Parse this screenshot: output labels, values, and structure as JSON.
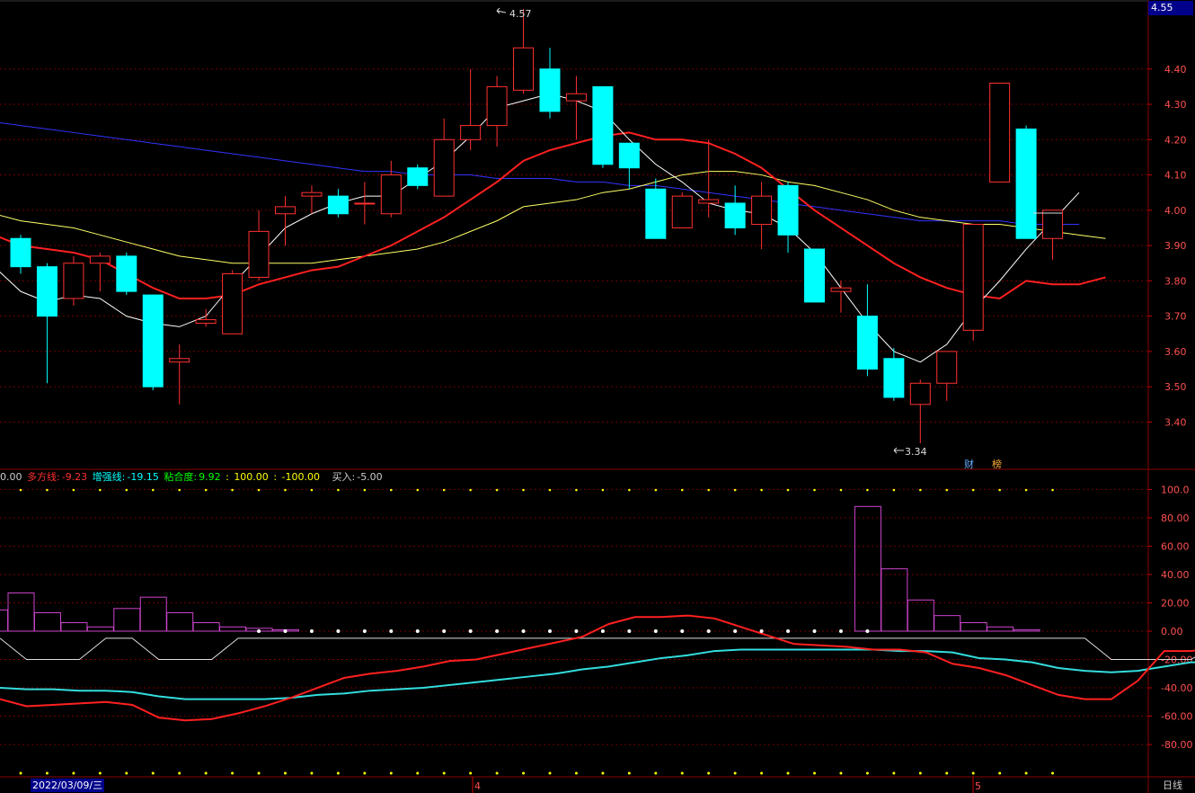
{
  "price_box": "4.55",
  "indicator": {
    "prefix": "0.00",
    "duo_label": "多方线:",
    "duo_value": "-9.23",
    "zq_label": "增强线:",
    "zq_value": "-19.15",
    "nhd_label": "粘合度:",
    "nhd_value": "9.92",
    "c100": "100.00",
    "cm100": "-100.00",
    "buy_label": "买入:",
    "buy_value": "-5.00",
    "sep1": ":",
    "sep2": ":"
  },
  "date_box": "2022/03/09/三",
  "period_label": "日线",
  "events": [
    "财",
    "榜"
  ],
  "colors": {
    "up": "#ff3030",
    "down": "#00ffff",
    "ma5": "#ffffff",
    "ma10": "#ff2020",
    "ma20": "#ffff66",
    "ma60": "#3333ff",
    "grid": "#8b0000",
    "hist": "#cc44cc"
  },
  "chart_data": [
    {
      "type": "candlestick",
      "price_axis": {
        "ylim": [
          3.31,
          4.58
        ],
        "ticks": [
          "4.40",
          "4.30",
          "4.20",
          "4.10",
          "4.00",
          "3.90",
          "3.80",
          "3.70",
          "3.60",
          "3.50",
          "3.40"
        ]
      },
      "x_month_marks": [
        "4",
        "5"
      ],
      "annotations": {
        "high": "4.57",
        "low": "3.34"
      },
      "candles": [
        {
          "o": 3.92,
          "h": 3.93,
          "l": 3.82,
          "c": 3.84
        },
        {
          "o": 3.84,
          "h": 3.85,
          "l": 3.51,
          "c": 3.7
        },
        {
          "o": 3.75,
          "h": 3.87,
          "l": 3.73,
          "c": 3.85
        },
        {
          "o": 3.85,
          "h": 3.88,
          "l": 3.77,
          "c": 3.87
        },
        {
          "o": 3.87,
          "h": 3.88,
          "l": 3.76,
          "c": 3.77
        },
        {
          "o": 3.76,
          "h": 3.76,
          "l": 3.49,
          "c": 3.5
        },
        {
          "o": 3.57,
          "h": 3.62,
          "l": 3.45,
          "c": 3.58
        },
        {
          "o": 3.68,
          "h": 3.72,
          "l": 3.67,
          "c": 3.69
        },
        {
          "o": 3.65,
          "h": 3.83,
          "l": 3.65,
          "c": 3.82
        },
        {
          "o": 3.81,
          "h": 4.0,
          "l": 3.8,
          "c": 3.94
        },
        {
          "o": 3.99,
          "h": 4.04,
          "l": 3.9,
          "c": 4.01
        },
        {
          "o": 4.04,
          "h": 4.07,
          "l": 3.99,
          "c": 4.05
        },
        {
          "o": 4.04,
          "h": 4.06,
          "l": 3.98,
          "c": 3.99
        },
        {
          "o": 4.02,
          "h": 4.08,
          "l": 3.96,
          "c": 4.02
        },
        {
          "o": 3.99,
          "h": 4.14,
          "l": 3.98,
          "c": 4.1
        },
        {
          "o": 4.12,
          "h": 4.13,
          "l": 4.06,
          "c": 4.07
        },
        {
          "o": 4.04,
          "h": 4.26,
          "l": 4.04,
          "c": 4.2
        },
        {
          "o": 4.2,
          "h": 4.4,
          "l": 4.17,
          "c": 4.24
        },
        {
          "o": 4.24,
          "h": 4.38,
          "l": 4.18,
          "c": 4.35
        },
        {
          "o": 4.34,
          "h": 4.57,
          "l": 4.33,
          "c": 4.46
        },
        {
          "o": 4.4,
          "h": 4.46,
          "l": 4.26,
          "c": 4.28
        },
        {
          "o": 4.31,
          "h": 4.38,
          "l": 4.2,
          "c": 4.33
        },
        {
          "o": 4.35,
          "h": 4.35,
          "l": 4.12,
          "c": 4.13
        },
        {
          "o": 4.19,
          "h": 4.19,
          "l": 4.06,
          "c": 4.12
        },
        {
          "o": 4.06,
          "h": 4.09,
          "l": 3.92,
          "c": 3.92
        },
        {
          "o": 3.95,
          "h": 4.05,
          "l": 3.95,
          "c": 4.04
        },
        {
          "o": 4.02,
          "h": 4.2,
          "l": 3.98,
          "c": 4.03
        },
        {
          "o": 4.02,
          "h": 4.07,
          "l": 3.93,
          "c": 3.95
        },
        {
          "o": 3.96,
          "h": 4.08,
          "l": 3.89,
          "c": 4.04
        },
        {
          "o": 4.07,
          "h": 4.08,
          "l": 3.88,
          "c": 3.93
        },
        {
          "o": 3.89,
          "h": 3.89,
          "l": 3.74,
          "c": 3.74
        },
        {
          "o": 3.77,
          "h": 3.8,
          "l": 3.71,
          "c": 3.78
        },
        {
          "o": 3.7,
          "h": 3.79,
          "l": 3.53,
          "c": 3.55
        },
        {
          "o": 3.58,
          "h": 3.61,
          "l": 3.46,
          "c": 3.47
        },
        {
          "o": 3.45,
          "h": 3.52,
          "l": 3.34,
          "c": 3.51
        },
        {
          "o": 3.51,
          "h": 3.6,
          "l": 3.46,
          "c": 3.6
        },
        {
          "o": 3.66,
          "h": 3.96,
          "l": 3.63,
          "c": 3.96
        },
        {
          "o": 4.08,
          "h": 4.36,
          "l": 4.08,
          "c": 4.36
        },
        {
          "o": 4.23,
          "h": 4.24,
          "l": 3.93,
          "c": 3.92
        },
        {
          "o": 3.92,
          "h": 4.0,
          "l": 3.86,
          "c": 4.0
        }
      ],
      "ma5": [
        3.84,
        3.77,
        3.74,
        3.76,
        3.75,
        3.7,
        3.68,
        3.67,
        3.7,
        3.79,
        3.87,
        3.95,
        3.99,
        4.02,
        4.04,
        4.04,
        4.09,
        4.14,
        4.21,
        4.29,
        4.31,
        4.33,
        4.31,
        4.28,
        4.2,
        4.13,
        4.08,
        4.02,
        4.0,
        3.99,
        3.95,
        3.88,
        3.78,
        3.68,
        3.6,
        3.57,
        3.62,
        3.72,
        3.8,
        3.89,
        3.97,
        4.05
      ],
      "ma10": [
        3.93,
        3.9,
        3.89,
        3.88,
        3.86,
        3.82,
        3.78,
        3.75,
        3.75,
        3.76,
        3.79,
        3.81,
        3.83,
        3.84,
        3.87,
        3.9,
        3.94,
        3.98,
        4.03,
        4.08,
        4.14,
        4.17,
        4.19,
        4.21,
        4.22,
        4.2,
        4.2,
        4.19,
        4.16,
        4.12,
        4.06,
        4.0,
        3.95,
        3.9,
        3.85,
        3.81,
        3.78,
        3.76,
        3.75,
        3.8,
        3.79,
        3.79,
        3.81
      ],
      "ma20": [
        3.99,
        3.97,
        3.96,
        3.95,
        3.93,
        3.91,
        3.89,
        3.87,
        3.86,
        3.85,
        3.85,
        3.85,
        3.85,
        3.86,
        3.87,
        3.88,
        3.89,
        3.91,
        3.94,
        3.97,
        4.01,
        4.02,
        4.03,
        4.05,
        4.06,
        4.08,
        4.1,
        4.11,
        4.11,
        4.1,
        4.08,
        4.07,
        4.05,
        4.03,
        4.0,
        3.98,
        3.97,
        3.96,
        3.96,
        3.95,
        3.94,
        3.93,
        3.92
      ],
      "ma60": [
        4.25,
        4.24,
        4.23,
        4.22,
        4.21,
        4.2,
        4.19,
        4.18,
        4.17,
        4.16,
        4.15,
        4.14,
        4.13,
        4.12,
        4.11,
        4.11,
        4.1,
        4.1,
        4.1,
        4.09,
        4.09,
        4.09,
        4.08,
        4.08,
        4.07,
        4.07,
        4.06,
        4.05,
        4.04,
        4.03,
        4.02,
        4.01,
        4.0,
        3.99,
        3.98,
        3.97,
        3.97,
        3.97,
        3.97,
        3.96,
        3.96,
        3.96
      ]
    },
    {
      "type": "line",
      "ylim": [
        -100,
        110
      ],
      "ticks": [
        "100.0",
        "80.00",
        "60.00",
        "40.00",
        "20.00",
        "0.00",
        "-20.00",
        "-40.00",
        "-60.00",
        "-80.00"
      ],
      "series": [
        {
          "name": "多方线",
          "values": [
            -48,
            -53,
            -52,
            -51,
            -50,
            -52,
            -61,
            -63,
            -62,
            -58,
            -53,
            -47,
            -40,
            -33,
            -30,
            -28,
            -25,
            -21,
            -20,
            -16,
            -12,
            -8,
            -4,
            5,
            10,
            10,
            11,
            9,
            3,
            -3,
            -9,
            -10,
            -11,
            -13,
            -13,
            -15,
            -23,
            -26,
            -31,
            -38,
            -45,
            -48,
            -48,
            -35,
            -14,
            -14,
            -12,
            -10,
            -9
          ]
        },
        {
          "name": "增强线",
          "values": [
            -40,
            -41,
            -41,
            -42,
            -42,
            -43,
            -46,
            -48,
            -48,
            -48,
            -48,
            -47,
            -45,
            -44,
            -42,
            -41,
            -40,
            -38,
            -36,
            -34,
            -32,
            -30,
            -27,
            -25,
            -22,
            -19,
            -17,
            -14,
            -13,
            -13,
            -13,
            -13,
            -13,
            -13,
            -14,
            -14,
            -15,
            -19,
            -20,
            -22,
            -26,
            -28,
            -29,
            -28,
            -25,
            -22,
            -22,
            -20,
            -19
          ]
        },
        {
          "name": "粘合度",
          "values": [
            -5,
            -20,
            -20,
            -20,
            -5,
            -5,
            -20,
            -20,
            -20,
            -5,
            -5,
            -5,
            -5,
            -5,
            -5,
            -5,
            -5,
            -5,
            -5,
            -5,
            -5,
            -5,
            -5,
            -5,
            -5,
            -5,
            -5,
            -5,
            -5,
            -5,
            -5,
            -5,
            -5,
            -5,
            -5,
            -5,
            -5,
            -5,
            -5,
            -5,
            -5,
            -5,
            -20,
            -20,
            -20,
            -20,
            -10,
            -5,
            -5
          ]
        },
        {
          "name": "买入",
          "values": [
            15,
            27,
            13,
            6,
            3,
            16,
            24,
            13,
            6,
            3,
            2,
            1,
            0,
            0,
            0,
            0,
            0,
            0,
            0,
            0,
            0,
            0,
            0,
            0,
            0,
            0,
            0,
            0,
            0,
            0,
            0,
            0,
            0,
            88,
            44,
            22,
            11,
            6,
            3,
            1
          ]
        }
      ]
    }
  ]
}
